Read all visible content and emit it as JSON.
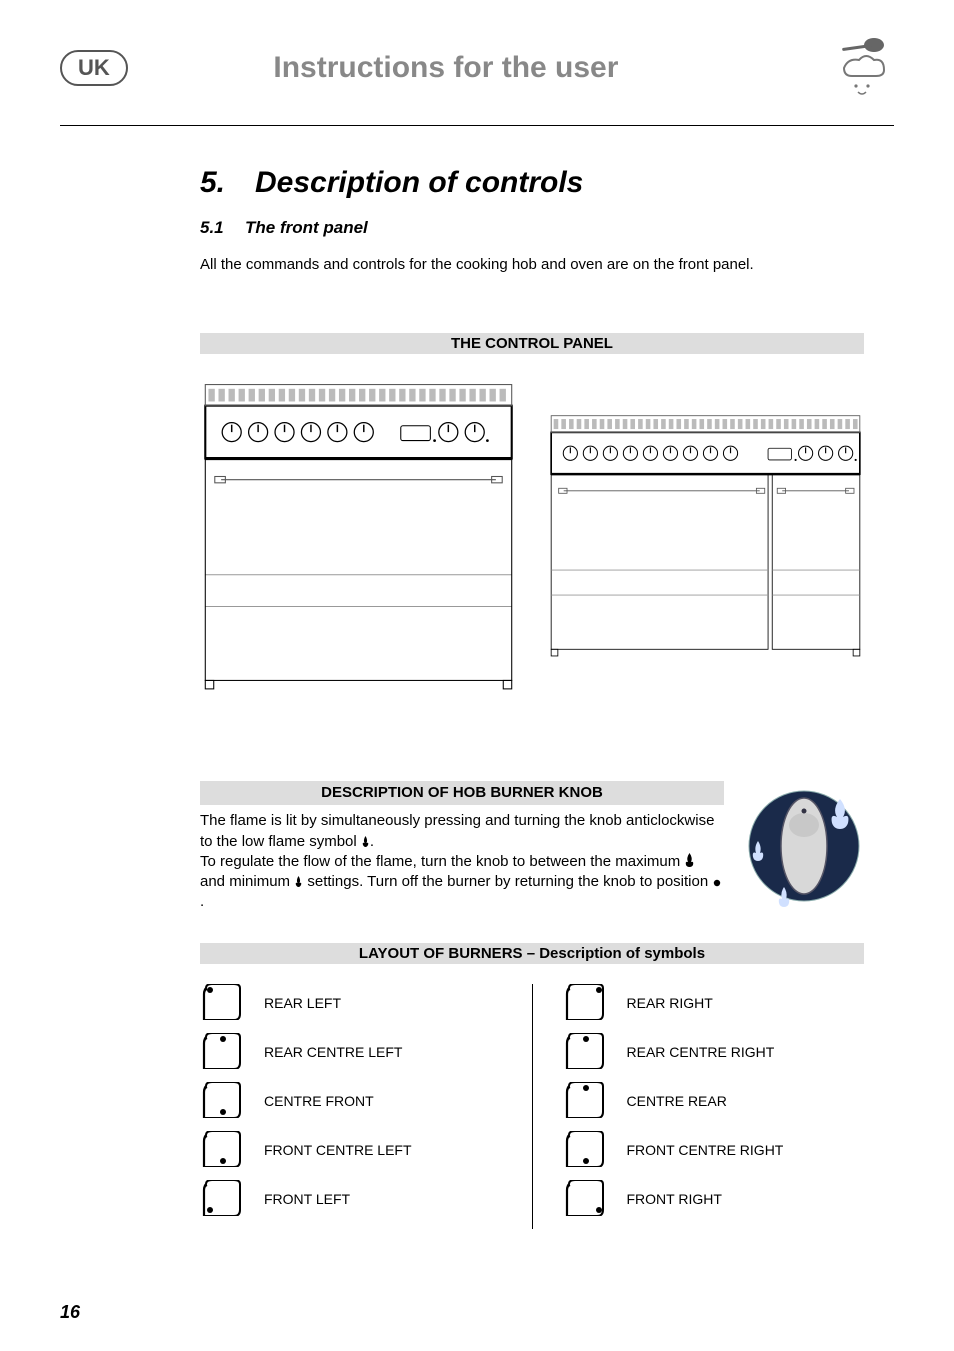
{
  "header": {
    "region": "UK",
    "title": "Instructions for the user"
  },
  "section": {
    "number": "5.",
    "title": "Description of controls"
  },
  "subsection": {
    "number": "5.1",
    "title": "The front panel"
  },
  "intro": "All the commands and controls for the cooking hob and oven are on the front panel.",
  "control_panel_heading": "THE CONTROL PANEL",
  "hob": {
    "heading": "DESCRIPTION OF HOB BURNER KNOB",
    "p1a": "The flame is lit by simultaneously pressing and turning the knob anticlockwise to the low flame symbol ",
    "p1b": ".",
    "p2a": "To regulate the flow of the flame, turn the knob to between the maximum ",
    "p2b": " and minimum ",
    "p2c": " settings. Turn off the burner by returning the knob to position ",
    "p2d": "."
  },
  "layout": {
    "heading": "LAYOUT OF BURNERS – Description of symbols",
    "left": [
      {
        "label": "REAR LEFT",
        "dot": "tl"
      },
      {
        "label": "REAR CENTRE LEFT",
        "dot": "tc"
      },
      {
        "label": "CENTRE FRONT",
        "dot": "bc"
      },
      {
        "label": "FRONT CENTRE LEFT",
        "dot": "bc"
      },
      {
        "label": "FRONT LEFT",
        "dot": "bl"
      }
    ],
    "right": [
      {
        "label": "REAR RIGHT",
        "dot": "tr"
      },
      {
        "label": "REAR CENTRE RIGHT",
        "dot": "tc"
      },
      {
        "label": "CENTRE REAR",
        "dot": "tc"
      },
      {
        "label": "FRONT CENTRE RIGHT",
        "dot": "bc"
      },
      {
        "label": "FRONT RIGHT",
        "dot": "br"
      }
    ]
  },
  "page_number": "16"
}
